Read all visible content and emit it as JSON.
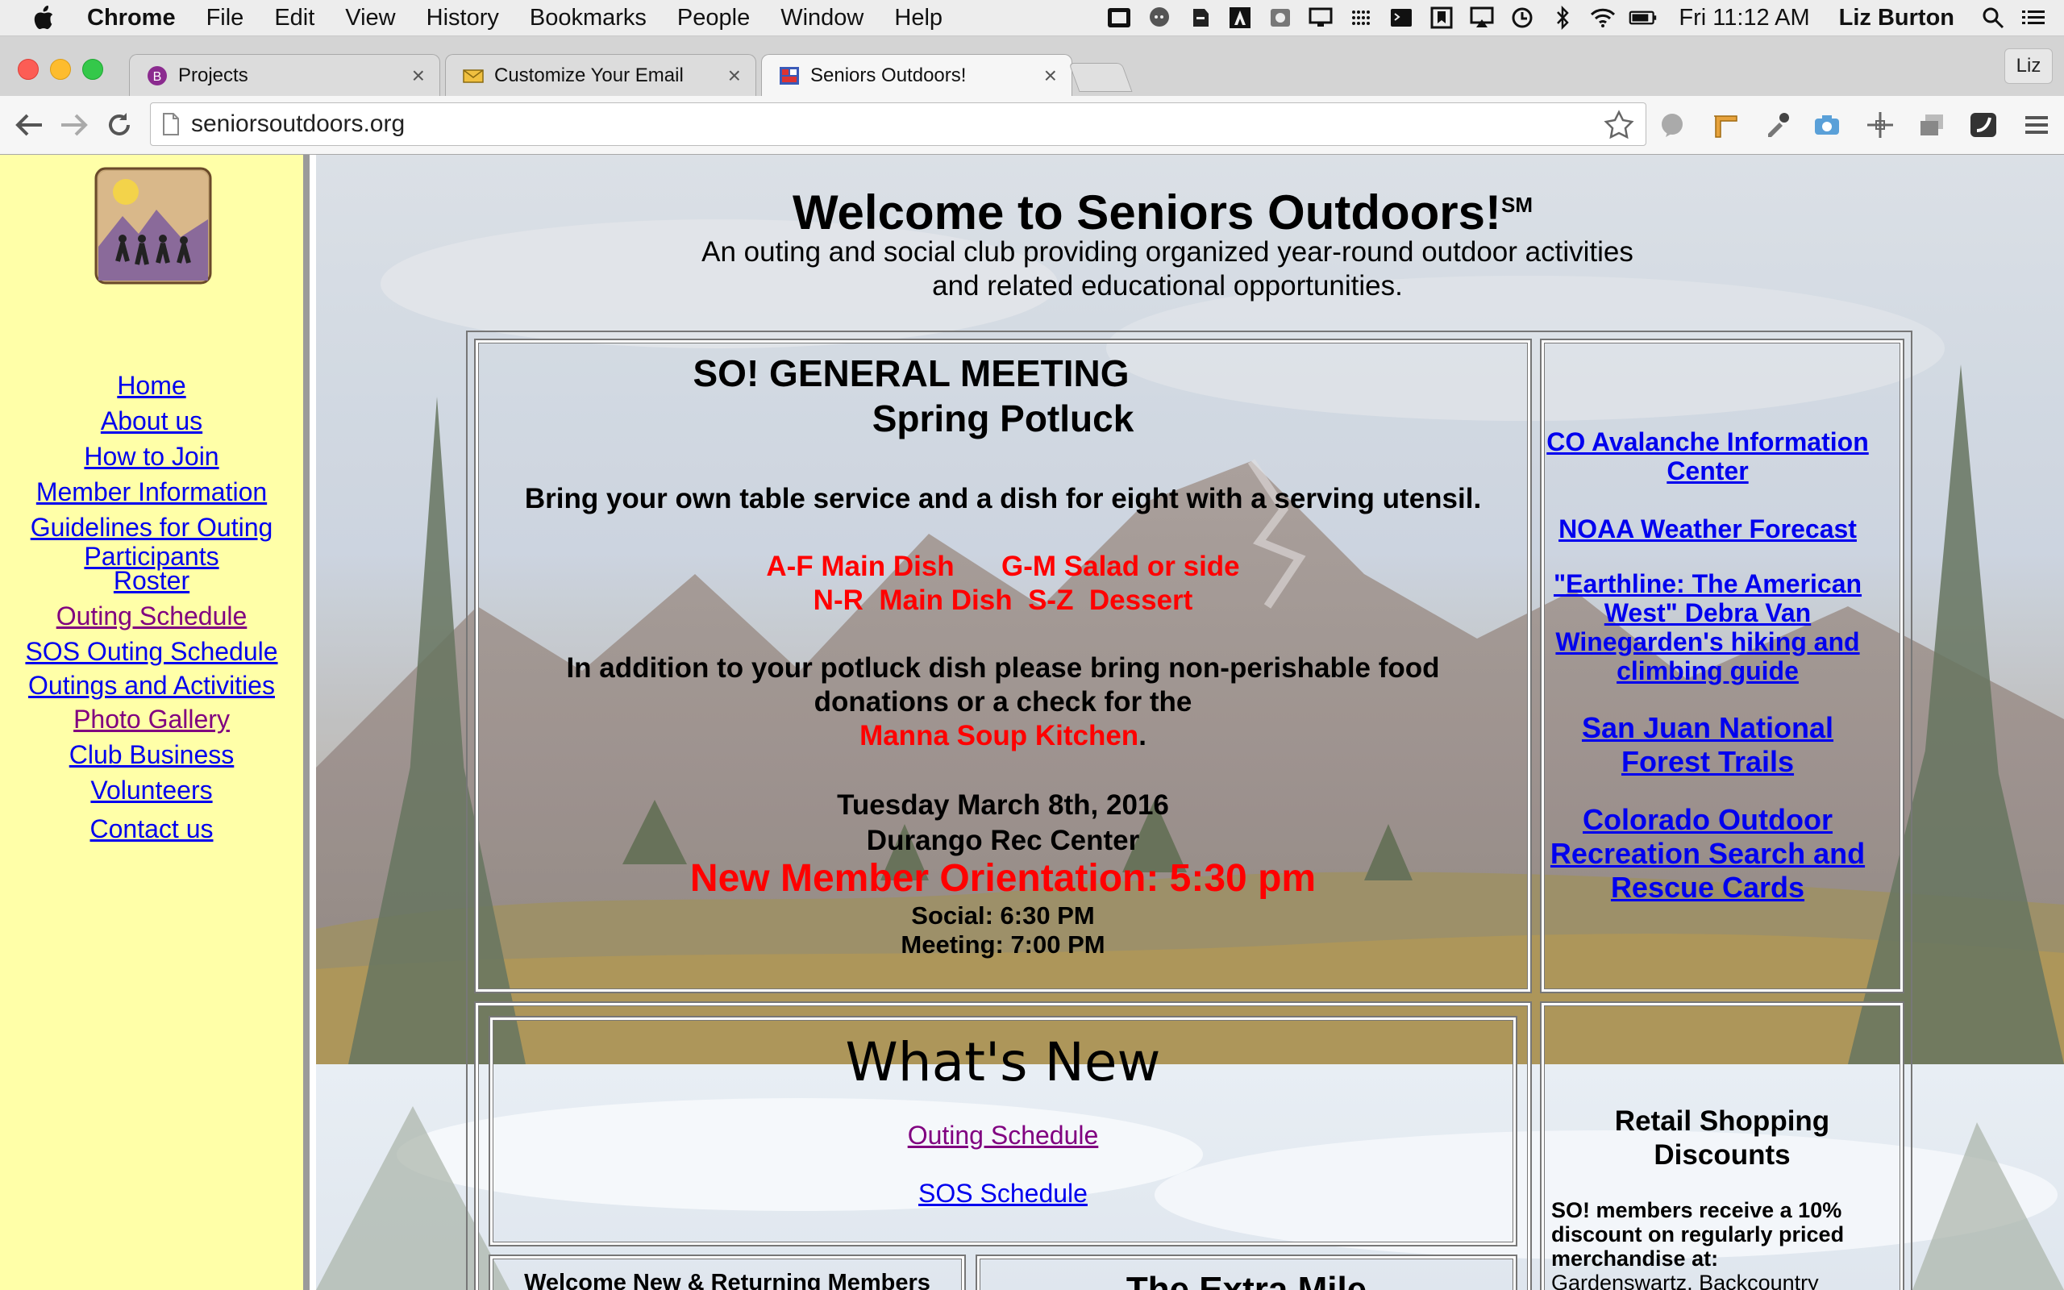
{
  "menubar": {
    "app_name": "Chrome",
    "items": [
      "File",
      "Edit",
      "View",
      "History",
      "Bookmarks",
      "People",
      "Window",
      "Help"
    ],
    "clock": "Fri 11:12 AM",
    "user": "Liz Burton"
  },
  "tabs": [
    {
      "title": "Projects",
      "close": "×"
    },
    {
      "title": "Customize Your Email",
      "close": "×"
    },
    {
      "title": "Seniors Outdoors!",
      "close": "×"
    }
  ],
  "profile_label": "Liz",
  "address_bar": {
    "url": "seniorsoutdoors.org"
  },
  "sidebar": {
    "links": [
      {
        "label": "Home",
        "visited": false
      },
      {
        "label": "About us",
        "visited": false
      },
      {
        "label": "How to Join",
        "visited": false
      },
      {
        "label": "Member Information",
        "visited": false
      },
      {
        "label": "Guidelines for Outing",
        "label2": "Participants",
        "visited": false
      },
      {
        "label": "Roster",
        "visited": false
      },
      {
        "label": "Outing Schedule",
        "visited": true
      },
      {
        "label": "SOS Outing Schedule",
        "visited": false
      },
      {
        "label": "Outings and Activities",
        "visited": false
      },
      {
        "label": "Photo Gallery",
        "visited": true
      },
      {
        "label": "Club Business",
        "visited": false
      },
      {
        "label": "Volunteers",
        "visited": false
      },
      {
        "label": "Contact us",
        "visited": false
      }
    ]
  },
  "header": {
    "title": "Welcome to Seniors Outdoors!",
    "title_mark": "SM",
    "subtitle_line1": "An outing and social club providing organized year-round outdoor activities",
    "subtitle_line2": "and related educational opportunities."
  },
  "meeting": {
    "title": "SO! GENERAL MEETING",
    "subtitle": "Spring Potluck",
    "instructions": "Bring your own table service and a dish for eight with a serving utensil.",
    "dish_line1": "A-F Main Dish      G-M Salad or side",
    "dish_line2": "N-R  Main Dish  S-Z  Dessert",
    "donation_line1": "In addition to your potluck dish please bring non-perishable food",
    "donation_line2": "donations or a check for the",
    "charity": "Manna Soup Kitchen",
    "charity_suffix": ".",
    "date": "Tuesday March 8th, 2016",
    "venue": "Durango Rec Center",
    "orientation": "New Member Orientation: 5:30 pm",
    "social": "Social: 6:30 PM",
    "meeting_time": "Meeting: 7:00 PM"
  },
  "right_links": {
    "avalanche_1": "CO Avalanche Information",
    "avalanche_2": "Center",
    "noaa": "NOAA Weather Forecast",
    "earthline_1": "\"Earthline: The American",
    "earthline_2": "West\" Debra Van",
    "earthline_3": "Winegarden's hiking and",
    "earthline_4": "climbing guide",
    "sanjuan_1": "San Juan National",
    "sanjuan_2": "Forest Trails",
    "cotrex_1": "Colorado Outdoor",
    "cotrex_2": "Recreation Search and",
    "cotrex_3": "Rescue Cards"
  },
  "whats_new": {
    "title": "What's New",
    "link1": "Outing Schedule",
    "link2": "SOS Schedule"
  },
  "welcome_box": "Welcome New & Returning Members",
  "extra_mile": "The Extra Mile",
  "retail": {
    "title_1": "Retail Shopping",
    "title_2": "Discounts",
    "line1": "SO! members receive a 10%",
    "line2": "discount on regularly priced",
    "line3": "merchandise at:",
    "line4": "Gardenswartz, Backcountry"
  },
  "colors": {
    "sidebar_bg": "#ffffa8",
    "link": "#0000ee",
    "visited_link": "#800080",
    "alert_red": "#ff0000"
  }
}
